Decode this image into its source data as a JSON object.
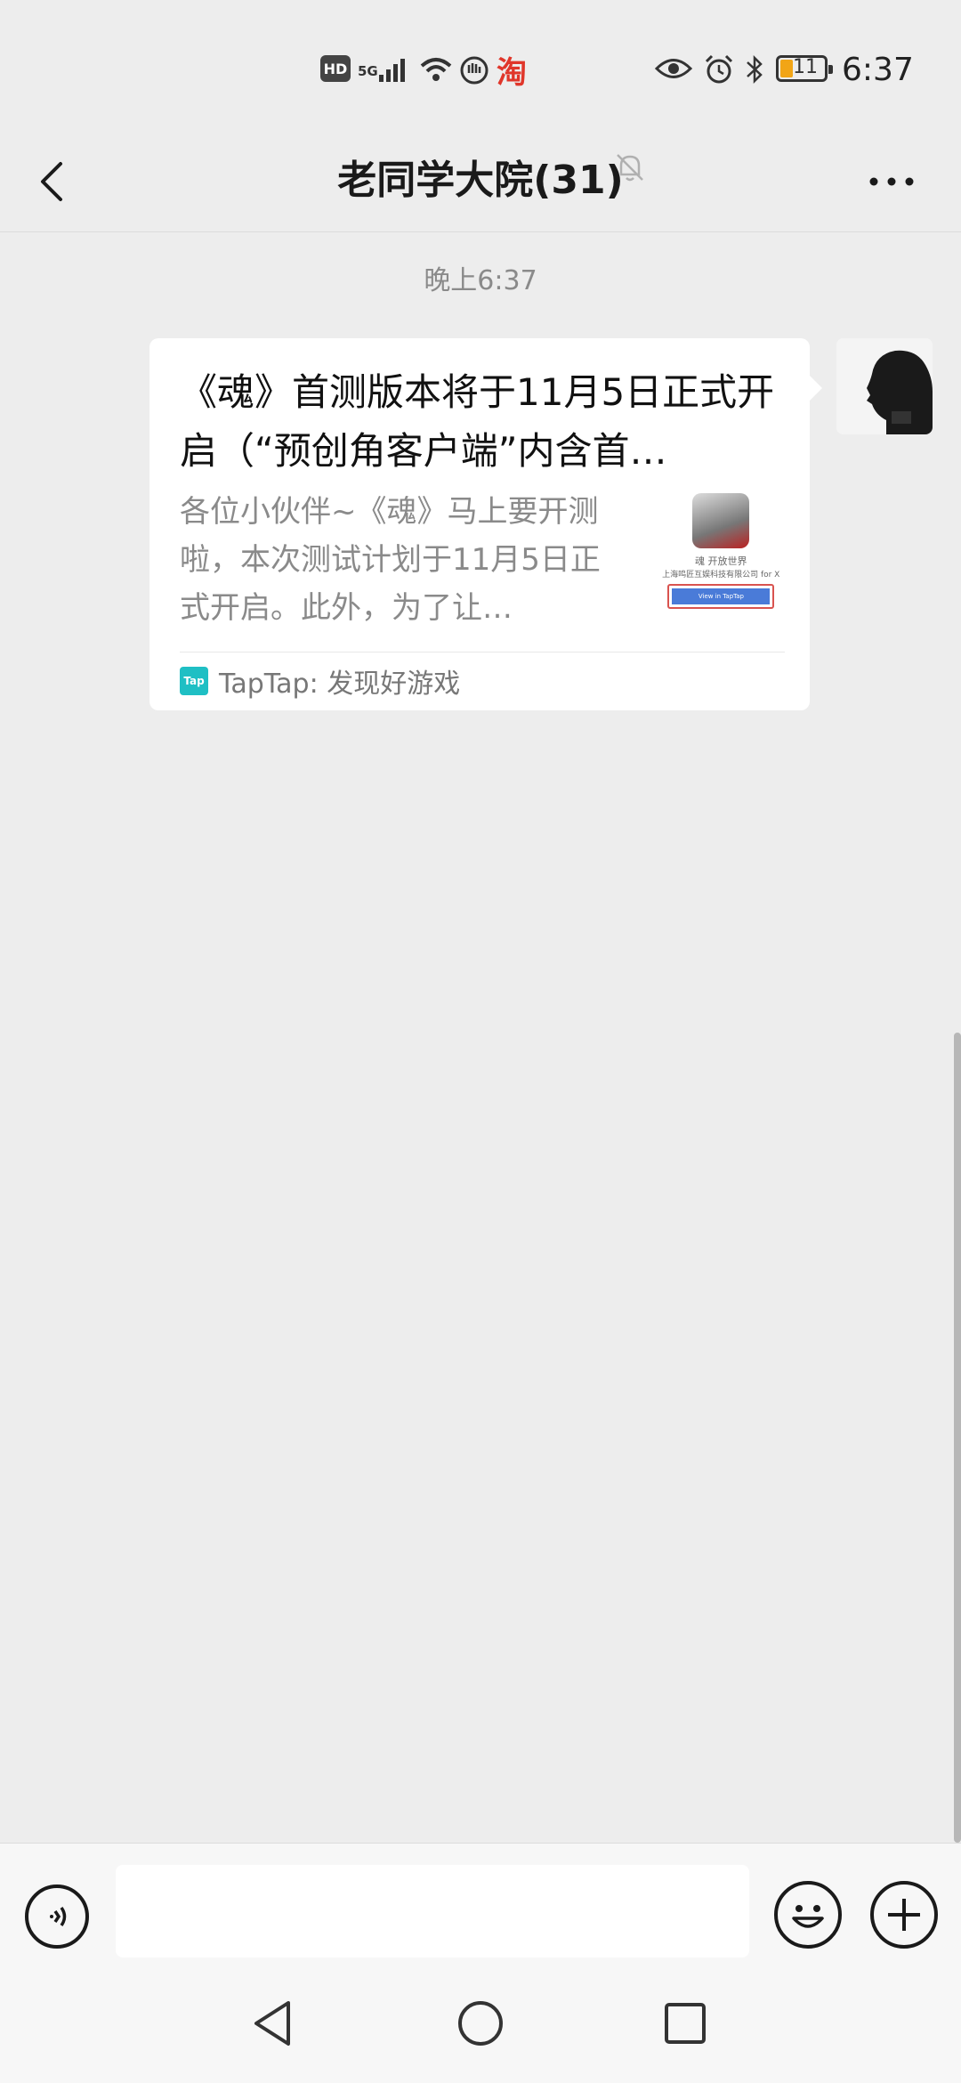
{
  "status_bar": {
    "hd": "HD",
    "network": "5G",
    "taobao_glyph": "淘",
    "battery": "11",
    "time": "6:37"
  },
  "header": {
    "title": "老同学大院(31)",
    "back_icon": "chevron-left-icon",
    "mute_icon": "bell-off-icon",
    "more_icon": "more-dots-icon"
  },
  "chat": {
    "timestamp": "晚上6:37",
    "message": {
      "title": "《魂》首测版本将于11月5日正式开启（“预创角客户端”内含首…",
      "description": "各位小伙伴~《魂》马上要开测啦，本次测试计划于11月5日正式开启。此外，为了让…",
      "thumb_text_1": "魂 开放世界",
      "thumb_text_2": "上海鸣匠互娱科技有限公司 for X",
      "thumb_button": "View in TapTap",
      "source_logo": "Tap",
      "source": "TapTap: 发现好游戏"
    }
  },
  "input_bar": {
    "text_value": "",
    "voice_icon": "voice-icon",
    "emoji_icon": "emoji-icon",
    "plus_icon": "plus-icon"
  },
  "nav": {
    "back_icon": "nav-back-icon",
    "home_icon": "nav-home-icon",
    "recent_icon": "nav-recent-icon"
  }
}
